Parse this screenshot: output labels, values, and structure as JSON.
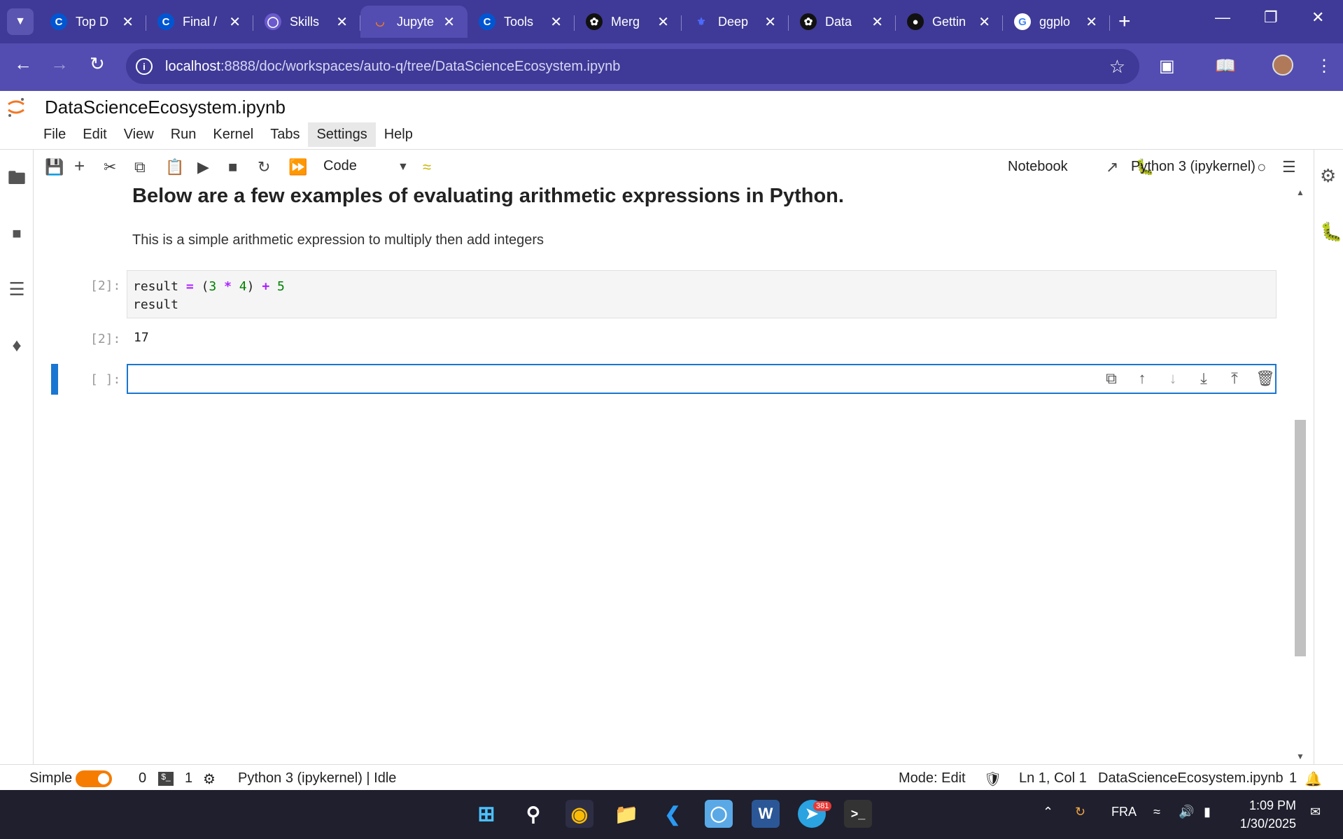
{
  "browser": {
    "tabs": [
      {
        "label": "Top D",
        "icon": "coursera-icon"
      },
      {
        "label": "Final /",
        "icon": "coursera-icon"
      },
      {
        "label": "Skills",
        "icon": "skills-icon"
      },
      {
        "label": "Jupyte",
        "icon": "jupyter-icon",
        "active": true
      },
      {
        "label": "Tools",
        "icon": "coursera-icon"
      },
      {
        "label": "Merg",
        "icon": "openai-icon"
      },
      {
        "label": "Deep",
        "icon": "deepseek-icon"
      },
      {
        "label": "Data",
        "icon": "openai-icon"
      },
      {
        "label": "Gettin",
        "icon": "github-icon"
      },
      {
        "label": "ggplo",
        "icon": "google-icon"
      }
    ],
    "url_host": "localhost",
    "url_rest": ":8888/doc/workspaces/auto-q/tree/DataScienceEcosystem.ipynb"
  },
  "jupyter": {
    "notebook_title": "DataScienceEcosystem.ipynb",
    "menu": [
      "File",
      "Edit",
      "View",
      "Run",
      "Kernel",
      "Tabs",
      "Settings",
      "Help"
    ],
    "cell_type": "Code",
    "notebook_label": "Notebook",
    "kernel": "Python 3 (ipykernel)"
  },
  "cells": {
    "heading": "Below are a few examples of evaluating arithmetic expressions in Python.",
    "paragraph": "This is a simple arithmetic expression to multiply then add integers",
    "code_prompt": "[2]:",
    "code_line1_a": "result",
    "code_line1_b": "=",
    "code_line1_c": "(",
    "code_line1_d": "3",
    "code_line1_e": "*",
    "code_line1_f": "4",
    "code_line1_g": ")",
    "code_line1_h": "+",
    "code_line1_i": "5",
    "code_line2": "result",
    "output_prompt": "[2]:",
    "output_value": "17",
    "empty_prompt": "[ ]:"
  },
  "status": {
    "mode_label": "Simple",
    "terminals_count": "0",
    "kernels_count": "1",
    "kernel_status": "Python 3 (ipykernel) | Idle",
    "mode": "Mode: Edit",
    "cursor": "Ln 1, Col 1",
    "filename": "DataScienceEcosystem.ipynb",
    "notifications": "1"
  },
  "taskbar": {
    "language": "FRA",
    "time": "1:09 PM",
    "date": "1/30/2025",
    "telegram_badge": "381"
  },
  "colors": {
    "browser_frame": "#3f3a97",
    "active_cell": "#1976d2",
    "toggle": "#f57c00"
  }
}
